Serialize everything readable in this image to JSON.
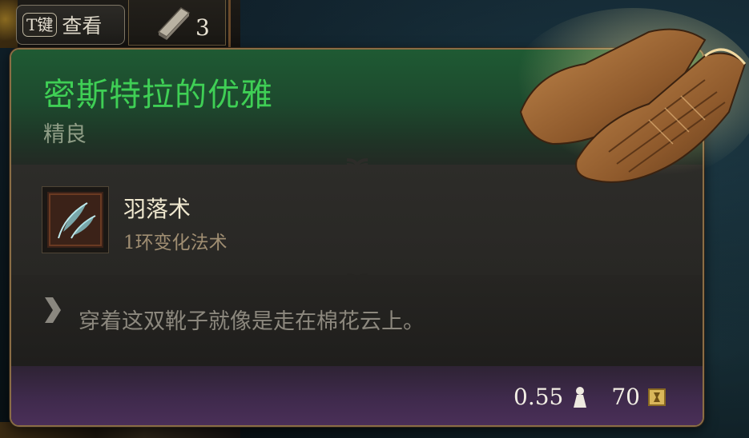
{
  "hud": {
    "key_cap": "T键",
    "key_action": "查看",
    "item_count": "3"
  },
  "tooltip": {
    "title": "密斯特拉的优雅",
    "rarity": "精良",
    "spell": {
      "name": "羽落术",
      "level": "1环变化法术",
      "icon": "feather-icon"
    },
    "description": "穿着这双靴子就像是走在棉花云上。",
    "weight": "0.55",
    "value": "70",
    "icons": {
      "weight": "weight-icon",
      "value": "coin-icon",
      "quote": "quote-icon"
    }
  },
  "colors": {
    "title_green": "#3fcf55",
    "border_bronze": "#8a6d45",
    "footer_purple": "#4a2f58"
  }
}
